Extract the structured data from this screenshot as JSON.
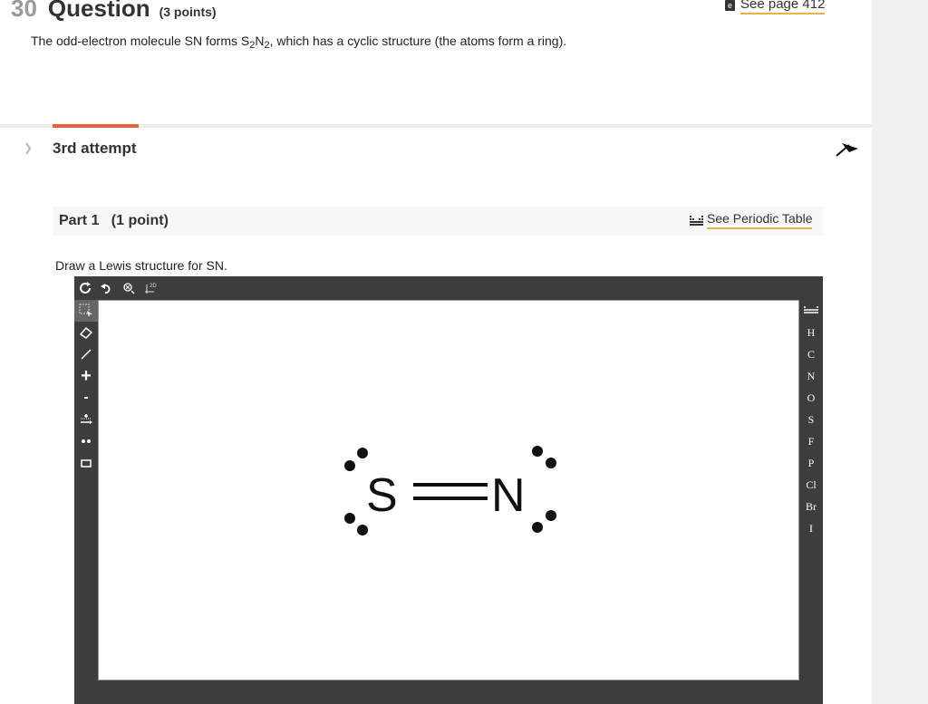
{
  "question": {
    "number": "30",
    "title": "Question",
    "points": "(3 points)",
    "see_page": "See page 412",
    "text_before": "The odd-electron molecule SN forms S",
    "sub1": "2",
    "text_mid": "N",
    "sub2": "2",
    "text_after": ", which has a cyclic structure (the atoms form a ring)."
  },
  "attempt": {
    "label": "3rd attempt"
  },
  "part": {
    "label": "Part 1   (1 point)",
    "periodic_table": "See Periodic Table"
  },
  "instruction": "Draw a Lewis structure for SN.",
  "editor": {
    "top_tools": [
      "clear-icon",
      "undo-icon",
      "zoom-icon",
      "2d-icon"
    ],
    "top_small_label": "2D",
    "left_tools": [
      "select-icon",
      "eraser-icon",
      "bond-icon",
      "add-charge-icon",
      "remove-charge-icon",
      "lone-pair-icon",
      "radical-icon",
      "box-icon"
    ],
    "plus": "+",
    "minus": "-",
    "elements": [
      "H",
      "C",
      "N",
      "O",
      "S",
      "F",
      "P",
      "Cl",
      "Br",
      "I"
    ],
    "molecule": {
      "atom1": "S",
      "atom2": "N",
      "bond": "double"
    }
  },
  "colors": {
    "accent": "#e8613c",
    "link_underline": "#e8b44a",
    "editor_bg": "#3d3d3d"
  }
}
